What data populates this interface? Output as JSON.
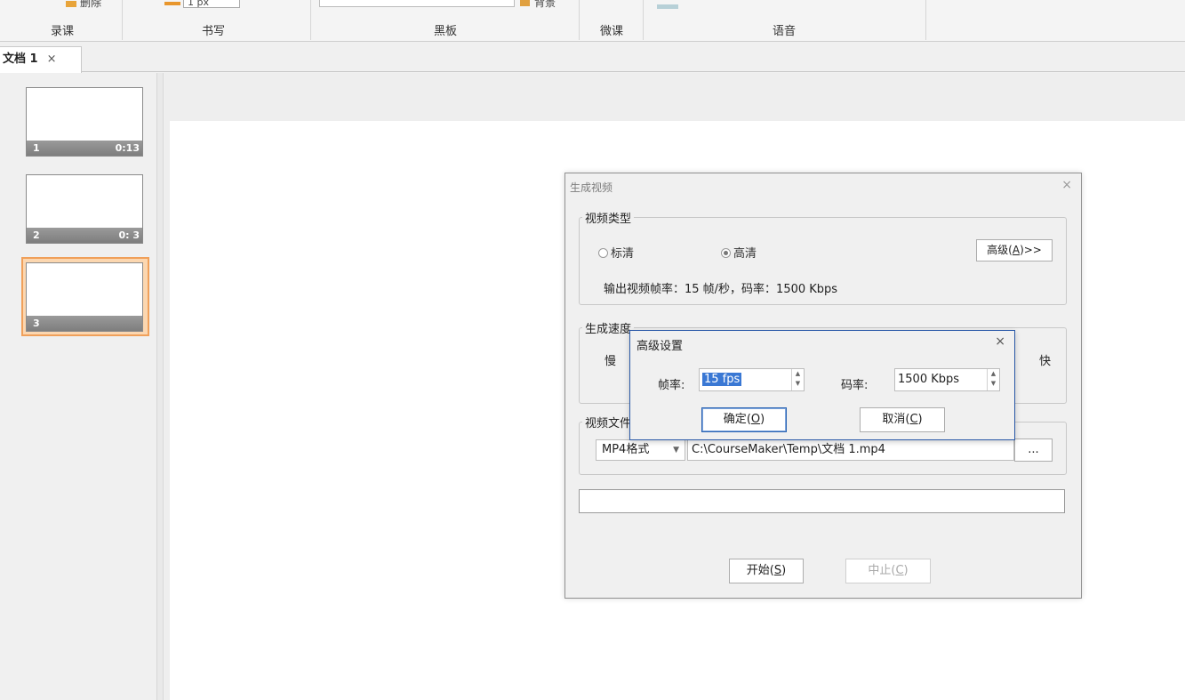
{
  "ribbon": {
    "cut_items": [
      "删除",
      "1 px",
      "背景"
    ],
    "groups": [
      "录课",
      "书写",
      "黑板",
      "微课",
      "语音"
    ]
  },
  "tab": {
    "label": "文档 1",
    "close": "×"
  },
  "thumbnails": [
    {
      "num": "1",
      "time": "0:13"
    },
    {
      "num": "2",
      "time": "0: 3"
    },
    {
      "num": "3",
      "time": ""
    }
  ],
  "dialog": {
    "title": "生成视频",
    "close": "×",
    "video_type": {
      "legend": "视频类型",
      "options": [
        "标清",
        "高清"
      ],
      "selected": "高清",
      "advanced_button": "高级",
      "advanced_key": "A",
      "advanced_suffix": ">>",
      "info": "输出视频帧率：15 帧/秒，码率：1500 Kbps"
    },
    "speed": {
      "legend": "生成速度",
      "slow": "慢",
      "fast": "快"
    },
    "file": {
      "legend": "视频文件",
      "format": "MP4格式",
      "path": "C:\\CourseMaker\\Temp\\文档 1.mp4",
      "browse": "..."
    },
    "start_button": "开始",
    "start_key": "S",
    "stop_button": "中止",
    "stop_key": "C"
  },
  "advanced": {
    "title": "高级设置",
    "close": "×",
    "fps_label": "帧率:",
    "fps_value": "15 fps",
    "bitrate_label": "码率:",
    "bitrate_value": "1500 Kbps",
    "ok_button": "确定",
    "ok_key": "O",
    "cancel_button": "取消",
    "cancel_key": "C"
  }
}
